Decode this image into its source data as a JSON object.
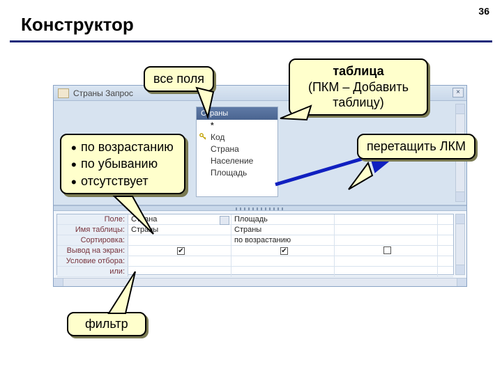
{
  "page_number": "36",
  "title": "Конструктор",
  "window": {
    "title": "Страны Запрос",
    "close": "×"
  },
  "table_box": {
    "header": "Страны",
    "star": "*",
    "fields": [
      "Код",
      "Страна",
      "Население",
      "Площадь"
    ]
  },
  "grid": {
    "labels": {
      "field": "Поле:",
      "table": "Имя таблицы:",
      "sort": "Сортировка:",
      "show": "Вывод на экран:",
      "criteria": "Условие отбора:",
      "or": "или:"
    },
    "cols": [
      {
        "field": "Страна",
        "table": "Страны",
        "sort": "",
        "show": true
      },
      {
        "field": "Площадь",
        "table": "Страны",
        "sort": "по возрастанию",
        "show": true
      },
      {
        "field": "",
        "table": "",
        "sort": "",
        "show": false
      }
    ]
  },
  "callouts": {
    "all_fields": "все поля",
    "table_title": "таблица",
    "table_sub": "(ПКМ – Добавить таблицу)",
    "drag": "перетащить ЛКМ",
    "sort_items": [
      "по возрастанию",
      "по убыванию",
      "отсутствует"
    ],
    "filter": "фильтр"
  }
}
